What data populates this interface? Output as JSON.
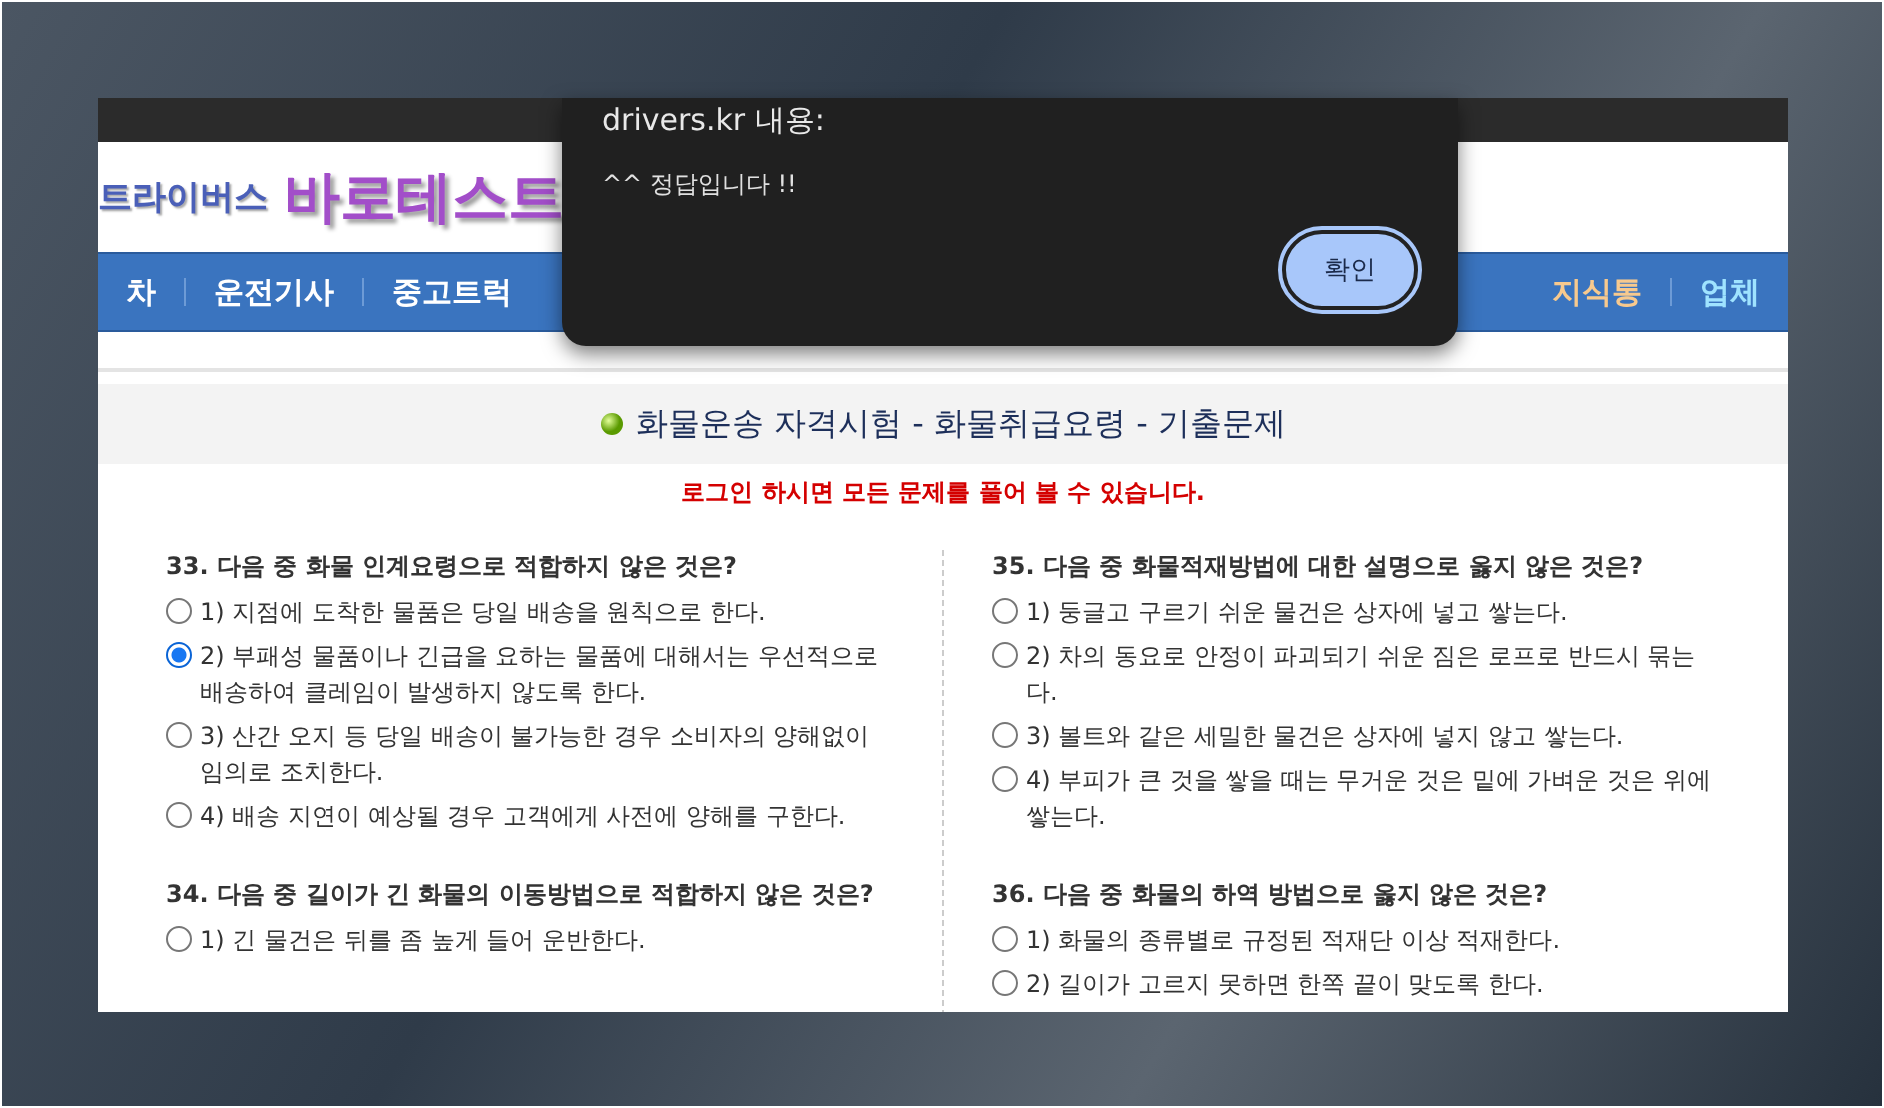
{
  "logo": {
    "prefix": "트라이버스",
    "name": "바로테스트"
  },
  "nav": {
    "left": [
      {
        "label": "차"
      },
      {
        "label": "운전기사"
      },
      {
        "label": "중고트럭"
      }
    ],
    "right": [
      {
        "label": "지식통",
        "color": "#f7c98e"
      },
      {
        "label": "업체",
        "color": "#9fe3ff"
      }
    ]
  },
  "page_title": "화물운송 자격시험 - 화물취급요령 - 기출문제",
  "notice": "로그인 하시면 모든 문제를 풀어 볼 수 있습니다.",
  "columns": [
    [
      {
        "question": "33. 다음 중 화물 인계요령으로 적합하지 않은 것은?",
        "options": [
          {
            "text": "1) 지점에 도착한 물품은 당일 배송을 원칙으로 한다.",
            "selected": false
          },
          {
            "text": "2) 부패성 물품이나 긴급을 요하는 물품에 대해서는 우선적으로 배송하여 클레임이 발생하지 않도록 한다.",
            "selected": true
          },
          {
            "text": "3) 산간 오지 등 당일 배송이 불가능한 경우 소비자의 양해없이 임의로 조치한다.",
            "selected": false
          },
          {
            "text": "4) 배송 지연이 예상될 경우 고객에게 사전에 양해를 구한다.",
            "selected": false
          }
        ]
      },
      {
        "question": "34. 다음 중 길이가 긴 화물의 이동방법으로 적합하지 않은 것은?",
        "options": [
          {
            "text": "1) 긴 물건은 뒤를 좀 높게 들어 운반한다.",
            "selected": false
          }
        ]
      }
    ],
    [
      {
        "question": "35. 다음 중 화물적재방법에 대한 설명으로 옳지 않은 것은?",
        "options": [
          {
            "text": "1) 둥글고 구르기 쉬운 물건은 상자에 넣고 쌓는다.",
            "selected": false
          },
          {
            "text": "2) 차의 동요로 안정이 파괴되기 쉬운 짐은 로프로 반드시 묶는다.",
            "selected": false
          },
          {
            "text": "3) 볼트와 같은 세밀한 물건은 상자에 넣지 않고 쌓는다.",
            "selected": false
          },
          {
            "text": "4) 부피가 큰 것을 쌓을 때는 무거운 것은 밑에 가벼운 것은 위에 쌓는다.",
            "selected": false
          }
        ]
      },
      {
        "question": "36. 다음 중 화물의 하역 방법으로 옳지 않은 것은?",
        "options": [
          {
            "text": "1) 화물의 종류별로 규정된 적재단 이상 적재한다.",
            "selected": false
          },
          {
            "text": "2) 길이가 고르지 못하면 한쪽 끝이 맞도록 한다.",
            "selected": false
          }
        ]
      }
    ]
  ],
  "dialog": {
    "title": "drivers.kr 내용:",
    "message": "^^ 정답입니다 !!",
    "button": "확인"
  }
}
